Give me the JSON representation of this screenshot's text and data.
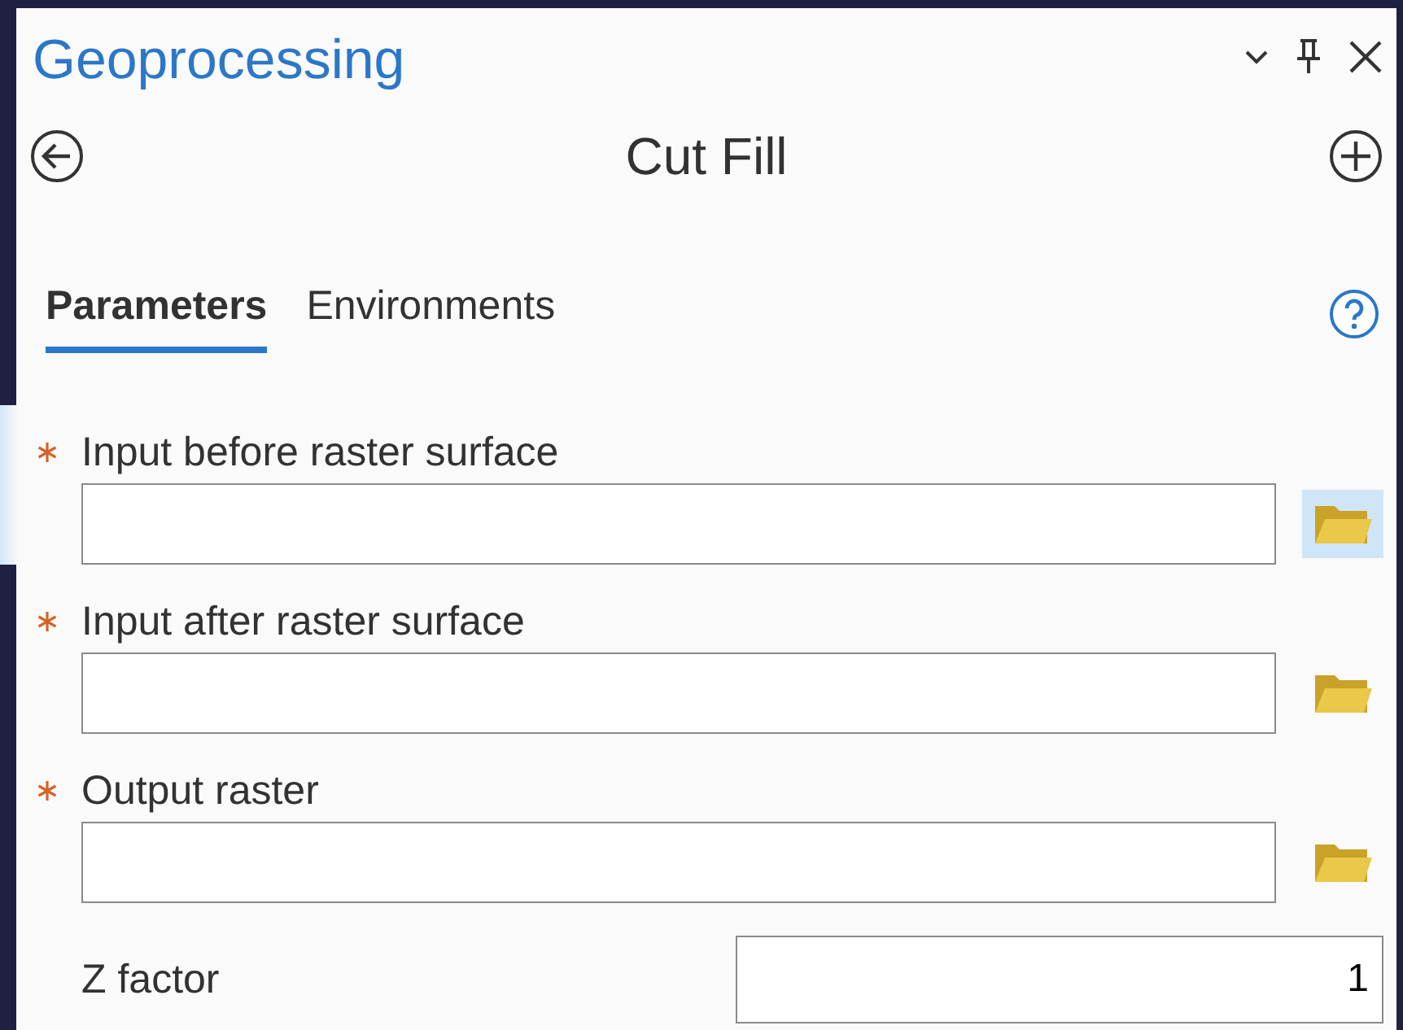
{
  "pane": {
    "title": "Geoprocessing"
  },
  "tool": {
    "title": "Cut Fill"
  },
  "tabs": [
    {
      "label": "Parameters",
      "selected": true
    },
    {
      "label": "Environments",
      "selected": false
    }
  ],
  "parameters": [
    {
      "kind": "raster",
      "label": "Input before raster surface",
      "required": true,
      "selected": true,
      "browse_hover": true
    },
    {
      "kind": "raster",
      "label": "Input after raster surface",
      "required": true,
      "selected": false,
      "browse_hover": false
    },
    {
      "kind": "raster",
      "label": "Output raster",
      "required": true,
      "selected": false,
      "browse_hover": false
    },
    {
      "kind": "number",
      "label": "Z factor",
      "required": false,
      "selected": false,
      "value": "1"
    }
  ]
}
